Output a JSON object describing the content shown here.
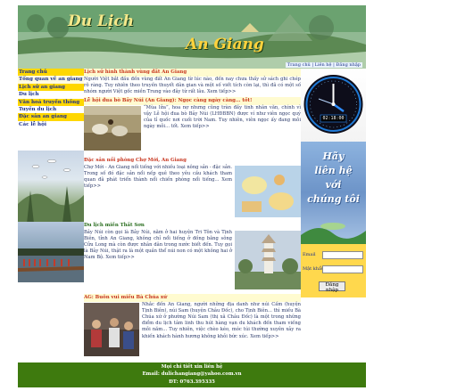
{
  "banner": {
    "logo_part1": "Du Lịch",
    "logo_part2": "An Giang",
    "link_text": "Trang chủ | Liên hệ | Đăng nhập"
  },
  "nav": {
    "items": [
      {
        "label": "Trang chủ",
        "style": "yellow"
      },
      {
        "label": "Tổng quan về an giang",
        "style": "cream"
      },
      {
        "label": "Lịch sử an giang",
        "style": "yellow"
      },
      {
        "label": "Du lịch",
        "style": "white"
      },
      {
        "label": "Văn hoá truyền thống",
        "style": "yellow"
      },
      {
        "label": "Tuyến du lịch",
        "style": "white"
      },
      {
        "label": "Đặc sản an giang",
        "style": "yellow"
      },
      {
        "label": "Các lễ hội",
        "style": "white"
      }
    ]
  },
  "main": {
    "sections": [
      {
        "title": "Lịch sử hình thành vùng đất An Giang",
        "text": "Người Việt bắt đầu đến vùng đất An Giang từ lúc nào, đến nay chưa thấy sử sách ghi chép rõ ràng. Tuy nhiên theo truyền thuyết dân gian và một số viết tích còn lại, thì đã có một số nhóm người Việt gốc miền Trung vào đây từ rất lâu. Xem tiếp>>"
      },
      {
        "title": "Lễ hội đua bò Bảy Núi (An Giang): Ngọc càng ngày càng... tốt!",
        "text": "“Mùa lửa”, hoa nợ nhưng cũng tràn đầy tinh nhân văn, chính vì vậy Lễ hội đua bò Bảy Núi (LHĐBBN) được ví như viên ngọc quý của tỉ quốc nơi cuối trời Nam. Tuy nhiên, viên ngọc ấy đang mỗi ngày mỗi... tốt. Xem tiếp>>"
      },
      {
        "title": "Đặc sản nổi phòng Chợ Mới, An Giang",
        "text": "Chợ Mới - An Giang nổi tiếng với nhiều loại nông sản - đặc sản. Trong số đó đặc sản nổi nếp quê theo yêu cầu khách tham quan đã phát triển thành nổi chiến phòng nổi tiếng... Xem tiếp>>"
      },
      {
        "title": "Du lịch miền Thất Sơn",
        "text": "Bảy Núi còn gọi là Bảy Núi, nằm ở hai huyện Tri Tôn và Tịnh Biên, tỉnh An Giang, không chỉ nổi tiếng ở đồng bằng sông Cửu Long mà còn được nhân dân trong nước biết đến. Tuy gọi là Bảy Núi, thật ra là một quần thể núi non có một không hai ở Nam Bộ. Xem tiếp>>"
      },
      {
        "title": "AG: Buôn vui miếu Bà Chúa xứ",
        "text": "Nhắc đến An Giang, người những địa danh như núi Cấm (huyện Tịnh Biên), núi Sam (huyện Châu Đốc), cho Tịnh Biên... thì miếu Bà Chúa xứ ở phường Núi Sam (thị xã Châu Đốc) là một trong những điểm du lịch tâm linh thu hút hàng vạn du khách đến tham viếng mỗi năm... Tuy nhiên, việc chèo kéo, móc túi thường xuyên xảy ra khiến khách hành hương không khỏi bức xúc. Xem tiếp>>"
      }
    ]
  },
  "right": {
    "clock_time": "02:18:00",
    "promo_line1": "Hãy",
    "promo_line2": "liên hệ",
    "promo_line3": "với",
    "promo_line4": "chúng tôi",
    "login_email_label": "Email",
    "login_password_label": "Mật khẩu",
    "login_button": "Đăng nhập"
  },
  "footer": {
    "line1": "Mọi chi tiết xin liên hệ",
    "line2": "Email: dulichangiang@yahoo.com.vn",
    "line3": "ĐT: 0763.395335"
  },
  "colors": {
    "nav_highlight": "#ffd700",
    "footer_green": "#3e7a0e",
    "title_red": "#c8361f",
    "login_yellow": "#ffd84d"
  }
}
